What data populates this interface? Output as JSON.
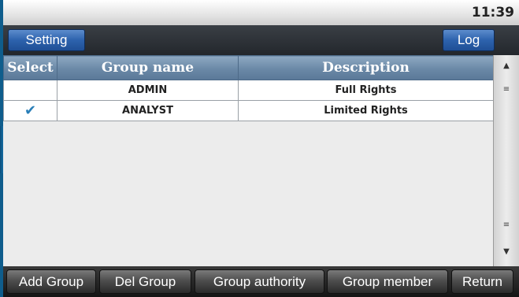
{
  "status": {
    "time": "11:39"
  },
  "toolbar": {
    "setting_label": "Setting",
    "log_label": "Log"
  },
  "table": {
    "columns": [
      "Select",
      "Group name",
      "Description"
    ],
    "rows": [
      {
        "selected": false,
        "group_name": "ADMIN",
        "description": "Full Rights"
      },
      {
        "selected": true,
        "check_glyph": "✔",
        "group_name": "ANALYST",
        "description": "Limited Rights"
      }
    ]
  },
  "scrollbar": {
    "up_glyph": "▲",
    "down_glyph": "▼",
    "grip_glyph": "≡"
  },
  "actions": {
    "add_group": "Add Group",
    "del_group": "Del Group",
    "group_authority": "Group authority",
    "group_member": "Group member",
    "return": "Return"
  },
  "colors": {
    "frame": "#0f5d8c",
    "button_blue": "#2d62ad",
    "check": "#2a7fb8",
    "header": "#6a88a6"
  }
}
